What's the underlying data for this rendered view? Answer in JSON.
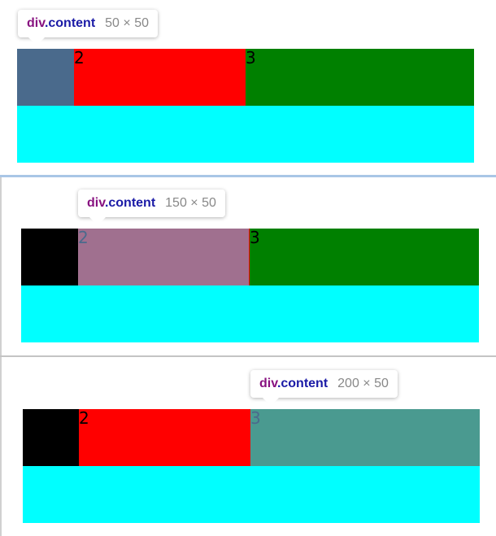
{
  "colors": {
    "box1": "#000000",
    "box2": "#ff0000",
    "box3": "#008000",
    "below": "#00ffff",
    "highlight1": "#4a6a8c",
    "highlight2": "#a0708f",
    "highlight3": "#4a9a90"
  },
  "panels": [
    {
      "tooltip": {
        "tag": "div",
        "cls": ".content",
        "dims": "50 × 50"
      },
      "boxes": [
        "",
        "2",
        "3"
      ],
      "highlighted": 0
    },
    {
      "tooltip": {
        "tag": "div",
        "cls": ".content",
        "dims": "150 × 50"
      },
      "boxes": [
        "",
        "2",
        "3"
      ],
      "highlighted": 1
    },
    {
      "tooltip": {
        "tag": "div",
        "cls": ".content",
        "dims": "200 × 50"
      },
      "boxes": [
        "",
        "2",
        "3"
      ],
      "highlighted": 2
    }
  ]
}
